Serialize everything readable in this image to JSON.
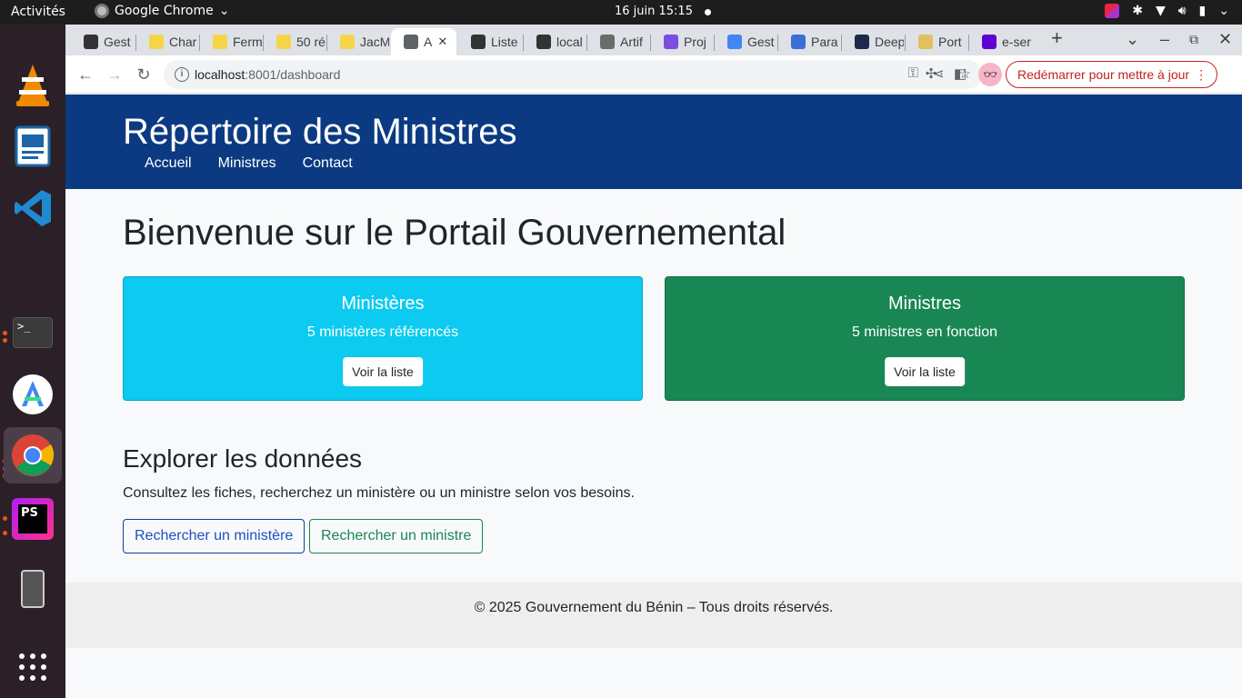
{
  "topbar": {
    "activities": "Activités",
    "app_name": "Google Chrome",
    "clock": "16 juin  15:15"
  },
  "dock": {
    "apps": [
      "vlc-icon",
      "libreoffice-impress-icon",
      "vscode-icon",
      "terminal-icon",
      "android-studio-icon",
      "chrome-icon",
      "phpstorm-icon",
      "phone-icon",
      "app-grid-icon"
    ]
  },
  "tabs": [
    {
      "label": "Gest",
      "favicon_color": "#333333"
    },
    {
      "label": "Char",
      "favicon_color": "#f5d547"
    },
    {
      "label": "Ferm",
      "favicon_color": "#f5d547"
    },
    {
      "label": "50 ré",
      "favicon_color": "#f5d547"
    },
    {
      "label": "JacM",
      "favicon_color": "#f5d547"
    },
    {
      "label": "A",
      "favicon_color": "#5f6368",
      "active": true
    },
    {
      "label": "Liste",
      "favicon_color": "#333333"
    },
    {
      "label": "local",
      "favicon_color": "#333333"
    },
    {
      "label": "Artif",
      "favicon_color": "#6b6b6b"
    },
    {
      "label": "Proj",
      "favicon_color": "#7b4de0"
    },
    {
      "label": "Gest",
      "favicon_color": "#4285f4"
    },
    {
      "label": "Para",
      "favicon_color": "#3b6fd6"
    },
    {
      "label": "Deep",
      "favicon_color": "#1b2a4a"
    },
    {
      "label": "Port",
      "favicon_color": "#e0c060"
    },
    {
      "label": "e-ser",
      "favicon_color": "#6001d2"
    }
  ],
  "toolbar": {
    "url_host": "localhost",
    "url_path": ":8001/dashboard",
    "update_label": "Redémarrer pour mettre à jour"
  },
  "site": {
    "title": "Répertoire des Ministres",
    "nav": [
      "Accueil",
      "Ministres",
      "Contact"
    ],
    "welcome": "Bienvenue sur le Portail Gouvernemental",
    "cards": [
      {
        "title": "Ministères",
        "text": "5 ministères référencés",
        "button": "Voir la liste",
        "color": "#0dcaf0"
      },
      {
        "title": "Ministres",
        "text": "5 ministres en fonction",
        "button": "Voir la liste",
        "color": "#198754"
      }
    ],
    "explore": {
      "title": "Explorer les données",
      "text": "Consultez les fiches, recherchez un ministère ou un ministre selon vos besoins.",
      "btn_ministere": "Rechercher un ministère",
      "btn_ministre": "Rechercher un ministre"
    },
    "footer": "© 2025 Gouvernement du Bénin – Tous droits réservés."
  }
}
